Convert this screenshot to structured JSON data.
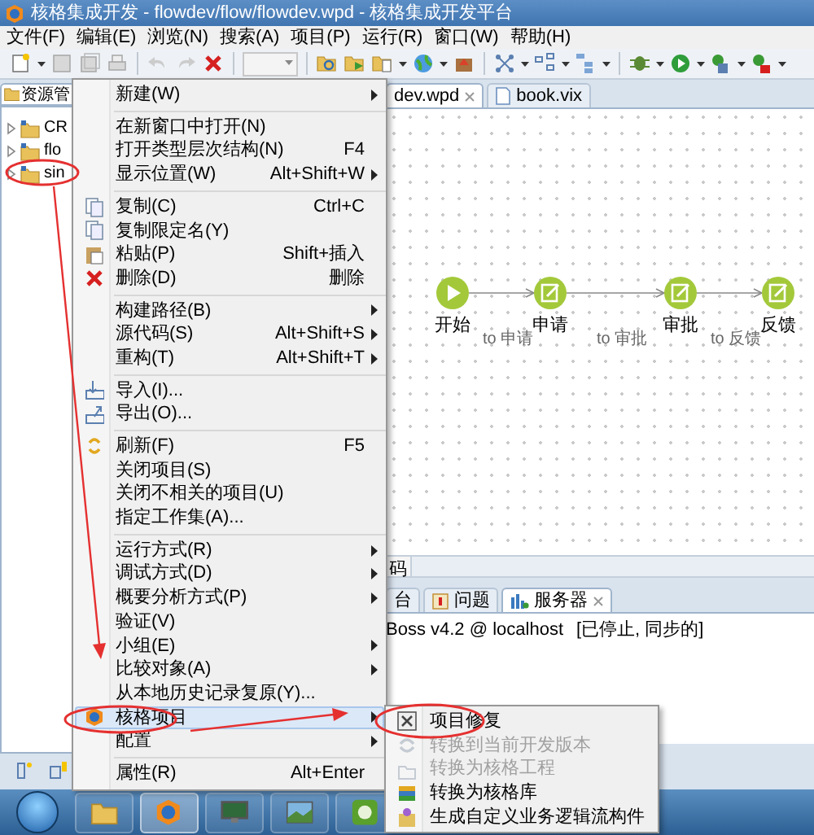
{
  "window": {
    "title": "核格集成开发 - flowdev/flow/flowdev.wpd - 核格集成开发平台"
  },
  "menu_bar": [
    "文件(F)",
    "编辑(E)",
    "浏览(N)",
    "搜索(A)",
    "项目(P)",
    "运行(R)",
    "窗口(W)",
    "帮助(H)"
  ],
  "explorer": {
    "tab": "资源管",
    "tree": [
      {
        "label": "CR"
      },
      {
        "label": "flo"
      },
      {
        "label": "sin"
      }
    ]
  },
  "editor": {
    "tabs": [
      {
        "label": "dev.wpd",
        "selected": true,
        "closable": true
      },
      {
        "label": "book.vix",
        "selected": false,
        "closable": false
      }
    ],
    "flow": {
      "nodes": [
        {
          "kind": "start",
          "label": "开始"
        },
        {
          "kind": "task",
          "label": "申请"
        },
        {
          "kind": "task",
          "label": "审批"
        },
        {
          "kind": "task",
          "label": "反馈"
        }
      ],
      "edges": [
        {
          "label": "to 申请"
        },
        {
          "label": "to 审批"
        },
        {
          "label": "to 反馈"
        }
      ]
    }
  },
  "bottom_panel": {
    "top_tab": "码",
    "tabs": [
      {
        "label": "台",
        "selected": false,
        "closable": false
      },
      {
        "label": "问题",
        "selected": false,
        "closable": false
      },
      {
        "label": "服务器",
        "selected": true,
        "closable": true
      }
    ],
    "servers": [
      {
        "name": "Boss v4.2 @ localhost",
        "state": "[已停止, 同步的]"
      }
    ]
  },
  "context_menu": {
    "items": [
      {
        "kind": "item",
        "label": "新建(W)",
        "submenu": true,
        "highlighted": false
      },
      {
        "kind": "separator"
      },
      {
        "kind": "item",
        "label": "在新窗口中打开(N)",
        "submenu": false,
        "highlighted": false
      },
      {
        "kind": "item",
        "label": "打开类型层次结构(N)",
        "shortcut": "F4",
        "submenu": false,
        "highlighted": false
      },
      {
        "kind": "item",
        "label": "显示位置(W)",
        "shortcut": "Alt+Shift+W",
        "submenu": true,
        "highlighted": false
      },
      {
        "kind": "separator"
      },
      {
        "kind": "item",
        "label": "复制(C)",
        "shortcut": "Ctrl+C",
        "submenu": false,
        "highlighted": false
      },
      {
        "kind": "item",
        "label": "复制限定名(Y)",
        "submenu": false,
        "highlighted": false
      },
      {
        "kind": "item",
        "label": "粘贴(P)",
        "shortcut": "Shift+插入",
        "submenu": false,
        "highlighted": false
      },
      {
        "kind": "item",
        "label": "删除(D)",
        "shortcut": "删除",
        "submenu": false,
        "highlighted": false
      },
      {
        "kind": "separator"
      },
      {
        "kind": "item",
        "label": "构建路径(B)",
        "submenu": true,
        "highlighted": false
      },
      {
        "kind": "item",
        "label": "源代码(S)",
        "shortcut": "Alt+Shift+S",
        "submenu": true,
        "highlighted": false
      },
      {
        "kind": "item",
        "label": "重构(T)",
        "shortcut": "Alt+Shift+T",
        "submenu": true,
        "highlighted": false
      },
      {
        "kind": "separator"
      },
      {
        "kind": "item",
        "label": "导入(I)...",
        "submenu": false,
        "highlighted": false
      },
      {
        "kind": "item",
        "label": "导出(O)...",
        "submenu": false,
        "highlighted": false
      },
      {
        "kind": "separator"
      },
      {
        "kind": "item",
        "label": "刷新(F)",
        "shortcut": "F5",
        "submenu": false,
        "highlighted": false
      },
      {
        "kind": "item",
        "label": "关闭项目(S)",
        "submenu": false,
        "highlighted": false
      },
      {
        "kind": "item",
        "label": "关闭不相关的项目(U)",
        "submenu": false,
        "highlighted": false
      },
      {
        "kind": "item",
        "label": "指定工作集(A)...",
        "submenu": false,
        "highlighted": false
      },
      {
        "kind": "separator"
      },
      {
        "kind": "item",
        "label": "运行方式(R)",
        "submenu": true,
        "highlighted": false
      },
      {
        "kind": "item",
        "label": "调试方式(D)",
        "submenu": true,
        "highlighted": false
      },
      {
        "kind": "item",
        "label": "概要分析方式(P)",
        "submenu": true,
        "highlighted": false
      },
      {
        "kind": "item",
        "label": "验证(V)",
        "submenu": false,
        "highlighted": false
      },
      {
        "kind": "item",
        "label": "小组(E)",
        "submenu": true,
        "highlighted": false
      },
      {
        "kind": "item",
        "label": "比较对象(A)",
        "submenu": true,
        "highlighted": false
      },
      {
        "kind": "item",
        "label": "从本地历史记录复原(Y)...",
        "submenu": false,
        "highlighted": false
      },
      {
        "kind": "item",
        "label": "核格项目",
        "submenu": true,
        "highlighted": true
      },
      {
        "kind": "item",
        "label": "配置",
        "submenu": true,
        "highlighted": false
      },
      {
        "kind": "separator"
      },
      {
        "kind": "item",
        "label": "属性(R)",
        "shortcut": "Alt+Enter",
        "submenu": false,
        "highlighted": false
      }
    ]
  },
  "submenu": {
    "items": [
      {
        "label": "项目修复",
        "disabled": false
      },
      {
        "label": "转换到当前开发版本",
        "disabled": true
      },
      {
        "label": "转换为核格工程",
        "disabled": true
      },
      {
        "label": "转换为核格库",
        "disabled": false
      },
      {
        "label": "生成自定义业务逻辑流构件",
        "disabled": false
      }
    ]
  }
}
